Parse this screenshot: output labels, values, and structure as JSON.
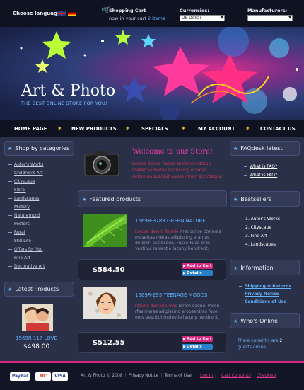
{
  "header": {
    "choose_language": "Choose language:",
    "cart_title": "Shopping Cart",
    "cart_sub": "now in your cart",
    "cart_items": "2 items",
    "currencies_label": "Currencies:",
    "currency_selected": "US Dollar",
    "manufacturers_label": "Manufacturers:",
    "manufacturer_selected": "---------------------"
  },
  "banner": {
    "logo": "Art & Photo",
    "slogan": "THE BEST ONLINE STORE FOR YOU!"
  },
  "nav": [
    "HOME PAGE",
    "NEW PRODUCTS",
    "SPECIALS",
    "MY ACCOUNT",
    "CONTACT US"
  ],
  "categories": {
    "title": "Shop by categories",
    "items": [
      "Autor's Works",
      "Children's Art",
      "Cityscape",
      "Floral",
      "Landscapes",
      "Mistery",
      "Naturemord",
      "Posters",
      "Rural",
      "Still Life",
      "Offers for You",
      "Fine Art",
      "Decorative Art"
    ]
  },
  "latest_products": {
    "title": "Latest Products",
    "name": "1569R-117 LOVE",
    "price": "$498.00"
  },
  "welcome": {
    "title": "Welcome to our Store!",
    "text": "Lerose delero froade metonce ctetue masertas meras adipiscing eramas deloreina suscipit varius mlum sociotsque."
  },
  "featured": {
    "title": "Featured products",
    "products": [
      {
        "name": "1569R-3789 GREEN NATURE",
        "text_hl": "Lerose delero froade",
        "text": " met conse cteteras masertas meras adipiscing eramas deloreri sociosque. Fusce Fuce eros vestibul molestie lacuny hendrerit.",
        "price": "$584.50"
      },
      {
        "name": "1569R-295 TEENAGE MOODS",
        "text_hl": "Mauris dertane mas",
        "text": " lorem caque. Pelen rfas meras adipiscing eroosentras fuce eros vestibul molestie lacuny hendrerit.",
        "price": "$512.55"
      }
    ],
    "add_to_cart": "Add to Cart",
    "details": "Details"
  },
  "faq": {
    "title": "FAQdesk latest",
    "items": [
      "What is FAQ?",
      "What is FAQ?"
    ]
  },
  "bestsellers": {
    "title": "Bestsellers",
    "items": [
      "1.  Autor's Works",
      "2.  Cityscape",
      "3.  Fine Art",
      "4.  Landscapes"
    ]
  },
  "information": {
    "title": "Information",
    "items": [
      "Shipping & Returns",
      "Privacy Notice",
      "Conditions of Use"
    ]
  },
  "whos_online": {
    "title": "Who's Online",
    "text_a": "There currently are",
    "count": "2",
    "text_b": "guests online."
  },
  "footer": {
    "paypal": "PayPal",
    "mastercard": "MC",
    "visa": "VISA",
    "copyright": "Art & Photo © 2008",
    "privacy": "Privacy Notice",
    "terms": "Terms of Use",
    "login": "Log In",
    "cart_contents": "Cart Contents",
    "checkout": "Checkout"
  },
  "colors": {
    "accent_pink": "#d6267f",
    "accent_blue": "#5fb2ff",
    "background": "#2a3047"
  }
}
